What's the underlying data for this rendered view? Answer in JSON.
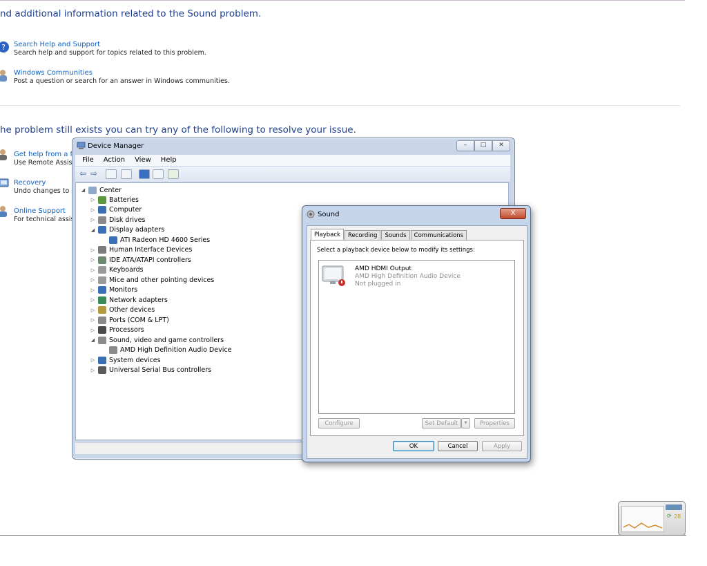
{
  "help_page": {
    "heading1": "nd additional information related to the Sound problem.",
    "links1": [
      {
        "title": "Search Help and Support",
        "desc": "Search help and support for topics related to this problem.",
        "icon": "help-icon"
      },
      {
        "title": "Windows Communities",
        "desc": "Post a question or search for an answer in Windows communities.",
        "icon": "people-icon"
      }
    ],
    "heading2": "he problem still exists you can try any of the following to resolve your issue.",
    "links2": [
      {
        "title": "Get help from a frie",
        "desc": "Use Remote Assistar",
        "icon": "remote-assistance-icon"
      },
      {
        "title": "Recovery",
        "desc": "Undo changes to sy",
        "icon": "recovery-icon"
      },
      {
        "title": "Online Support",
        "desc": "For technical assista",
        "icon": "online-support-icon"
      }
    ]
  },
  "device_manager": {
    "title": "Device Manager",
    "menu": [
      "File",
      "Action",
      "View",
      "Help"
    ],
    "root": "Center",
    "tree": [
      {
        "label": "Batteries",
        "level": 1,
        "exp": "▷",
        "color": "#5a9a3c"
      },
      {
        "label": "Computer",
        "level": 1,
        "exp": "▷",
        "color": "#3a6fb5"
      },
      {
        "label": "Disk drives",
        "level": 1,
        "exp": "▷",
        "color": "#8a8a8a"
      },
      {
        "label": "Display adapters",
        "level": 1,
        "exp": "◢",
        "color": "#3a6fb5"
      },
      {
        "label": "ATI Radeon HD 4600 Series",
        "level": 2,
        "exp": "",
        "color": "#3a6fb5"
      },
      {
        "label": "Human Interface Devices",
        "level": 1,
        "exp": "▷",
        "color": "#7b7b7b"
      },
      {
        "label": "IDE ATA/ATAPI controllers",
        "level": 1,
        "exp": "▷",
        "color": "#6e8a6e"
      },
      {
        "label": "Keyboards",
        "level": 1,
        "exp": "▷",
        "color": "#9a9a9a"
      },
      {
        "label": "Mice and other pointing devices",
        "level": 1,
        "exp": "▷",
        "color": "#9a9a9a"
      },
      {
        "label": "Monitors",
        "level": 1,
        "exp": "▷",
        "color": "#3a6fb5"
      },
      {
        "label": "Network adapters",
        "level": 1,
        "exp": "▷",
        "color": "#3a8a5a"
      },
      {
        "label": "Other devices",
        "level": 1,
        "exp": "▷",
        "color": "#b59a3a"
      },
      {
        "label": "Ports (COM & LPT)",
        "level": 1,
        "exp": "▷",
        "color": "#8a8a8a"
      },
      {
        "label": "Processors",
        "level": 1,
        "exp": "▷",
        "color": "#4a4a4a"
      },
      {
        "label": "Sound, video and game controllers",
        "level": 1,
        "exp": "◢",
        "color": "#8a8a8a"
      },
      {
        "label": "AMD High Definition Audio Device",
        "level": 2,
        "exp": "",
        "color": "#8a8a8a"
      },
      {
        "label": "System devices",
        "level": 1,
        "exp": "▷",
        "color": "#3a6fb5"
      },
      {
        "label": "Universal Serial Bus controllers",
        "level": 1,
        "exp": "▷",
        "color": "#5a5a5a"
      }
    ]
  },
  "sound_dialog": {
    "title": "Sound",
    "close": "X",
    "tabs": [
      "Playback",
      "Recording",
      "Sounds",
      "Communications"
    ],
    "active_tab": "Playback",
    "instruction": "Select a playback device below to modify its settings:",
    "device": {
      "name": "AMD HDMI Output",
      "description": "AMD High Definition Audio Device",
      "status": "Not plugged in",
      "icon": "monitor-speaker-icon"
    },
    "buttons": {
      "configure": "Configure",
      "set_default": "Set Default",
      "properties": "Properties",
      "ok": "OK",
      "cancel": "Cancel",
      "apply": "Apply"
    }
  },
  "tray_gadget": {
    "value": "28"
  }
}
